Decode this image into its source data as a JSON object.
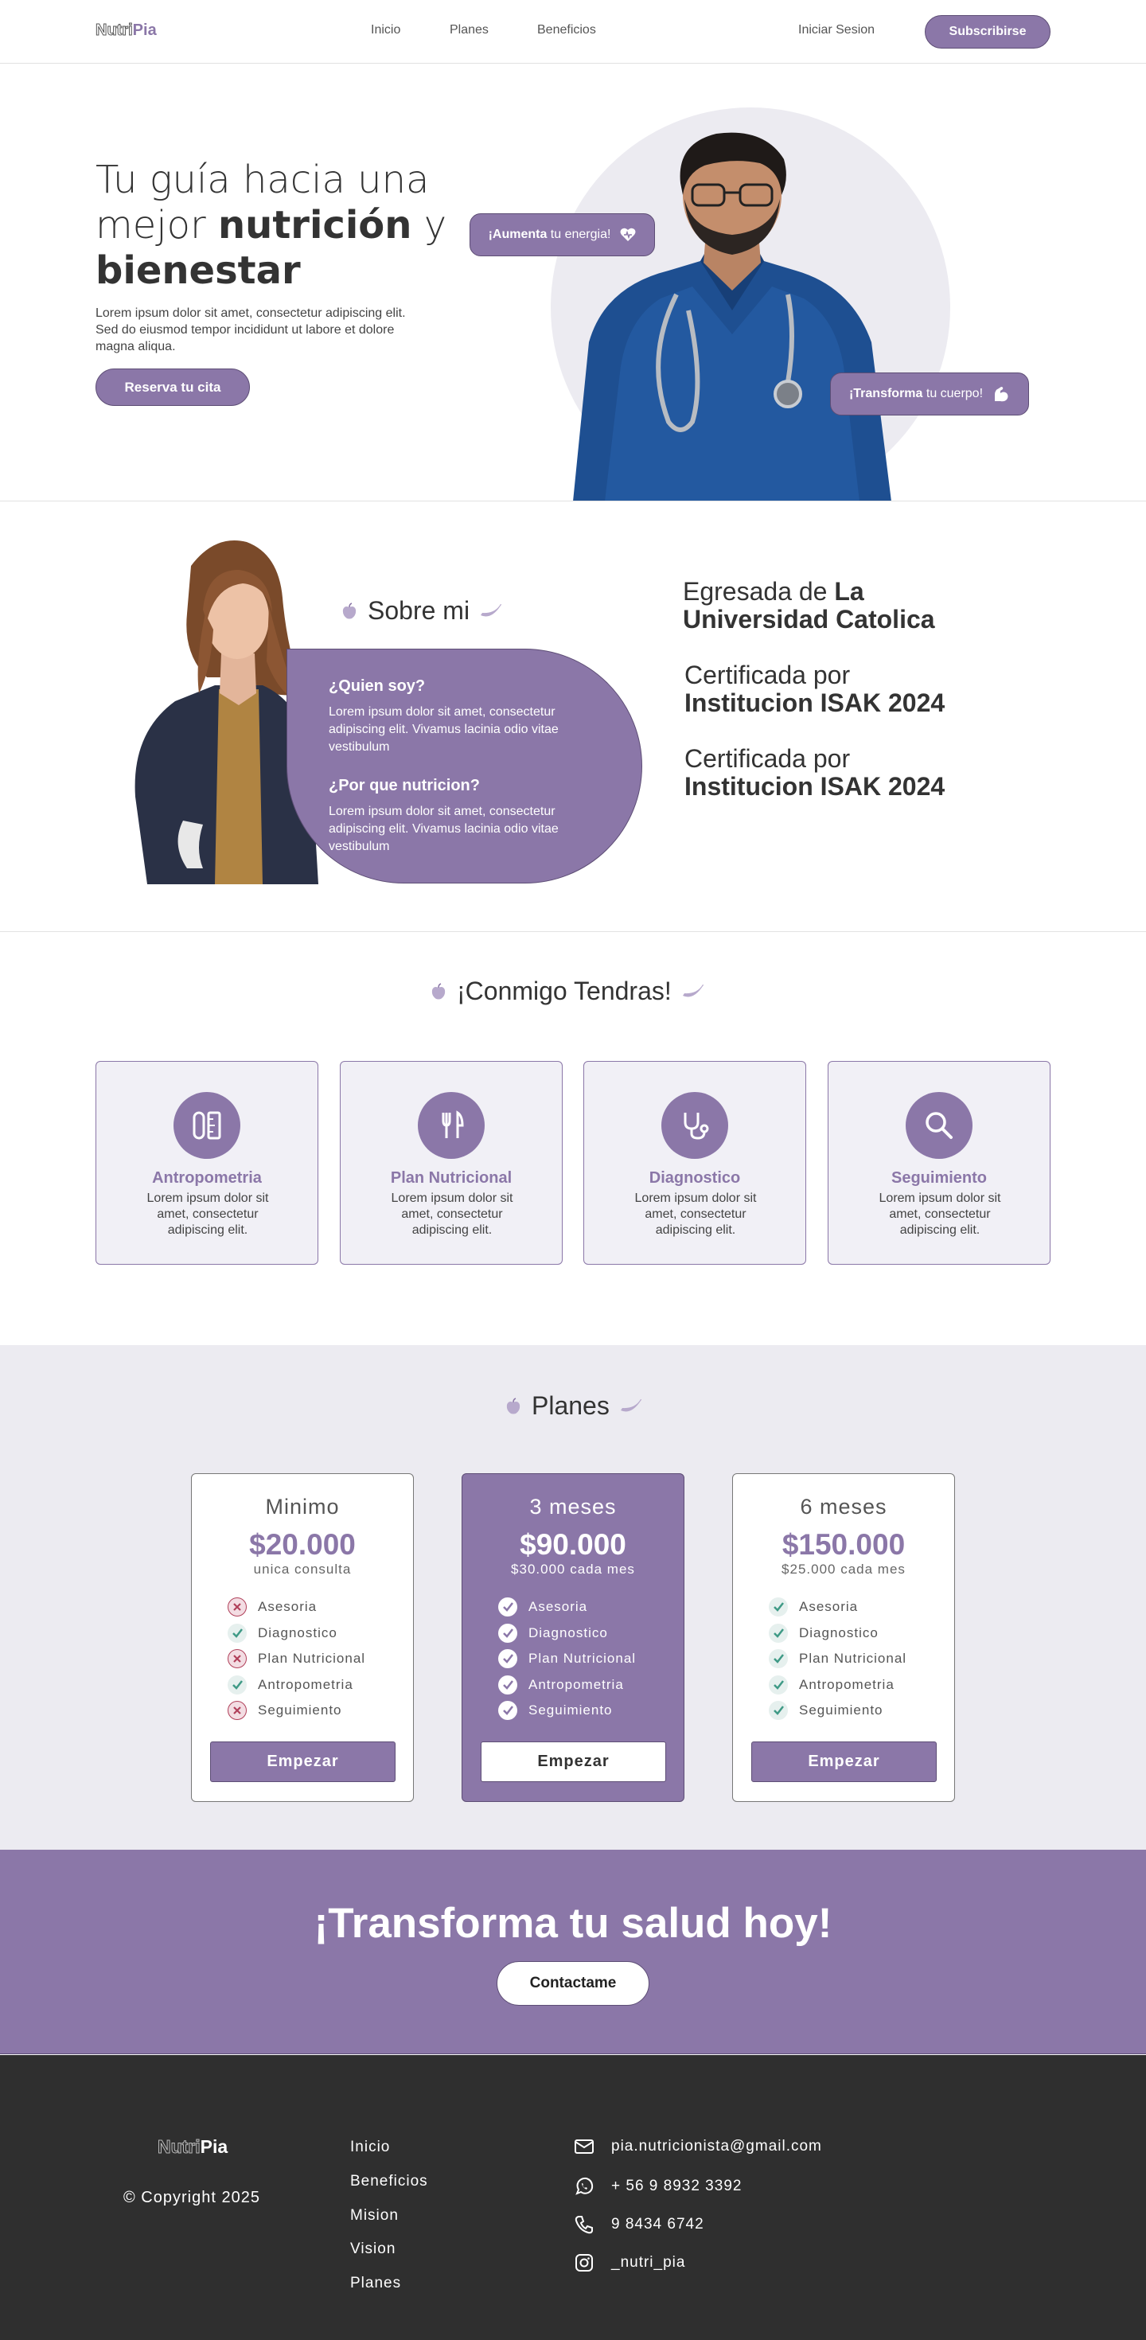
{
  "brand": {
    "part1": "Nutri",
    "part2": "Pia"
  },
  "nav": {
    "links": [
      "Inicio",
      "Planes",
      "Beneficios"
    ],
    "login": "Iniciar Sesion",
    "subscribe": "Subscribirse"
  },
  "hero": {
    "title_line1": "Tu guía hacia una",
    "title_pre": "mejor ",
    "title_bold1": "nutrición",
    "title_mid": " y",
    "title_bold2": "bienestar",
    "text": "Lorem ipsum dolor sit amet, consectetur adipiscing elit. Sed do eiusmod tempor incididunt ut labore et dolore magna aliqua.",
    "cta": "Reserva tu cita",
    "pill1_bold": "¡Aumenta",
    "pill1_rest": " tu energia!",
    "pill1_icon": "heart-icon",
    "pill2_bold": "¡Transforma",
    "pill2_rest": " tu cuerpo!",
    "pill2_icon": "flexed-arm-icon"
  },
  "about": {
    "title": "Sobre mi",
    "q1": "¿Quien soy?",
    "a1": "Lorem ipsum dolor sit amet, consectetur adipiscing elit. Vivamus lacinia odio vitae vestibulum",
    "q2": "¿Por que nutricion?",
    "a2": "Lorem ipsum dolor sit amet, consectetur adipiscing elit. Vivamus lacinia odio vitae vestibulum",
    "credentials": [
      {
        "pre": "Egresada de ",
        "bold_inline": "La",
        "bold_line": "Universidad Catolica"
      },
      {
        "pre": "Certificada por",
        "bold_inline": "",
        "bold_line": "Institucion ISAK 2024"
      },
      {
        "pre": "Certificada por",
        "bold_inline": "",
        "bold_line": "Institucion ISAK 2024"
      }
    ]
  },
  "services": {
    "title": "¡Conmigo Tendras!",
    "items": [
      {
        "title": "Antropometria",
        "text": "Lorem ipsum dolor sit amet, consectetur adipiscing elit.",
        "icon": "measure-icon"
      },
      {
        "title": "Plan Nutricional",
        "text": "Lorem ipsum dolor sit amet, consectetur adipiscing elit.",
        "icon": "fork-knife-icon"
      },
      {
        "title": "Diagnostico",
        "text": "Lorem ipsum dolor sit amet, consectetur adipiscing elit.",
        "icon": "stethoscope-icon"
      },
      {
        "title": "Seguimiento",
        "text": "Lorem ipsum dolor sit amet, consectetur adipiscing elit.",
        "icon": "magnifier-icon"
      }
    ]
  },
  "plans": {
    "title": "Planes",
    "items": [
      {
        "name": "Minimo",
        "price": "$20.000",
        "sub": "unica consulta",
        "button": "Empezar",
        "features": [
          {
            "label": "Asesoria",
            "included": false
          },
          {
            "label": "Diagnostico",
            "included": true
          },
          {
            "label": "Plan Nutricional",
            "included": false
          },
          {
            "label": "Antropometria",
            "included": true
          },
          {
            "label": "Seguimiento",
            "included": false
          }
        ]
      },
      {
        "name": "3 meses",
        "price": "$90.000",
        "sub": "$30.000 cada mes",
        "button": "Empezar",
        "features": [
          {
            "label": "Asesoria",
            "included": true
          },
          {
            "label": "Diagnostico",
            "included": true
          },
          {
            "label": "Plan Nutricional",
            "included": true
          },
          {
            "label": "Antropometria",
            "included": true
          },
          {
            "label": "Seguimiento",
            "included": true
          }
        ]
      },
      {
        "name": "6 meses",
        "price": "$150.000",
        "sub": "$25.000 cada mes",
        "button": "Empezar",
        "features": [
          {
            "label": "Asesoria",
            "included": true
          },
          {
            "label": "Diagnostico",
            "included": true
          },
          {
            "label": "Plan Nutricional",
            "included": true
          },
          {
            "label": "Antropometria",
            "included": true
          },
          {
            "label": "Seguimiento",
            "included": true
          }
        ]
      }
    ]
  },
  "cta": {
    "title": "¡Transforma tu salud hoy!",
    "button": "Contactame"
  },
  "footer": {
    "copyright": "© Copyright 2025",
    "links": [
      "Inicio",
      "Beneficios",
      "Mision",
      "Vision",
      "Planes"
    ],
    "contacts": [
      {
        "icon": "mail-icon",
        "text": "pia.nutricionista@gmail.com"
      },
      {
        "icon": "whatsapp-icon",
        "text": "+ 56 9 8932 3392"
      },
      {
        "icon": "phone-icon",
        "text": "9 8434 6742"
      },
      {
        "icon": "instagram-icon",
        "text": "_nutri_pia"
      }
    ]
  },
  "colors": {
    "accent": "#8b77a8",
    "accent_dark": "#5d4d75",
    "soft_bg": "#ecebf1",
    "footer_bg": "#2f2f2f",
    "check": "#3f9a86",
    "cross": "#b0405a"
  }
}
